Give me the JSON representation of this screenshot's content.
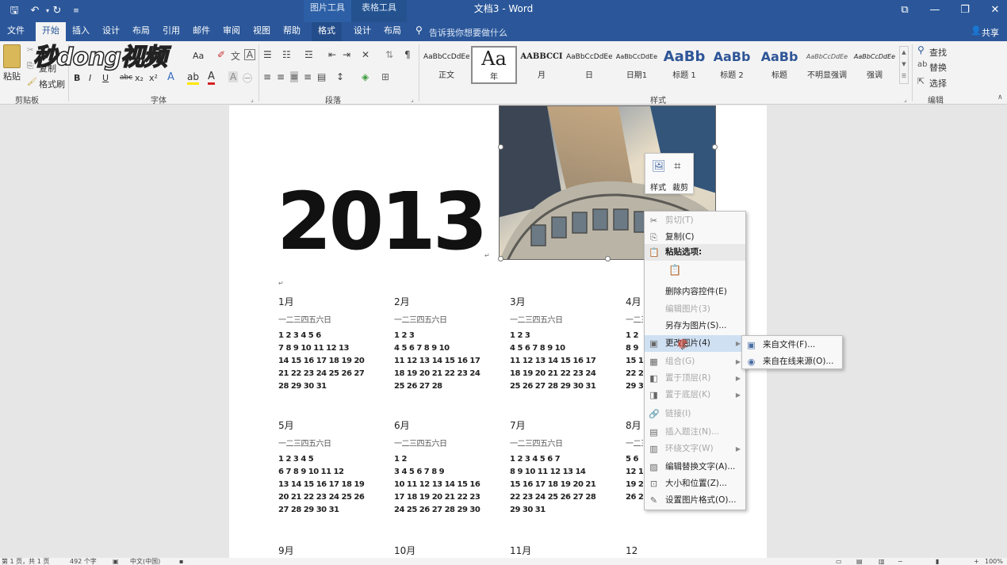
{
  "titlebar": {
    "title": "文档3 - Word",
    "context_tab_picture": "图片工具",
    "context_tab_table": "表格工具",
    "window_buttons": [
      "ribbon-display",
      "minimize",
      "restore",
      "close"
    ]
  },
  "tabs": [
    {
      "label": "文件"
    },
    {
      "label": "开始"
    },
    {
      "label": "插入"
    },
    {
      "label": "设计"
    },
    {
      "label": "布局"
    },
    {
      "label": "引用"
    },
    {
      "label": "邮件"
    },
    {
      "label": "审阅"
    },
    {
      "label": "视图"
    },
    {
      "label": "帮助"
    },
    {
      "label": "格式"
    },
    {
      "label": "设计"
    },
    {
      "label": "布局"
    }
  ],
  "tellme": "告诉我你想要做什么",
  "share": "共享",
  "ribbon": {
    "clipboard": {
      "paste": "粘贴",
      "copy": "复制",
      "format_painter": "格式刷",
      "label": "剪贴板"
    },
    "font": {
      "label": "字体",
      "case": "Aa",
      "bold": "B",
      "italic": "I",
      "underline": "U",
      "strike": "abc",
      "sub": "x₂",
      "sup": "x²"
    },
    "paragraph": {
      "label": "段落"
    },
    "styles": {
      "label": "样式",
      "items": [
        {
          "sample": "AaBbCcDdEe",
          "name": "正文"
        },
        {
          "sample": "Aa",
          "name": "年"
        },
        {
          "sample": "AABBCCI",
          "name": "月"
        },
        {
          "sample": "AaBbCcDdEe",
          "name": "日"
        },
        {
          "sample": "AaBbCcDdEe",
          "name": "日期1"
        },
        {
          "sample": "AaBb",
          "name": "标题 1"
        },
        {
          "sample": "AaBb",
          "name": "标题 2"
        },
        {
          "sample": "AaBb",
          "name": "标题"
        },
        {
          "sample": "AaBbCcDdEe",
          "name": "不明显强调"
        },
        {
          "sample": "AaBbCcDdEe",
          "name": "强调"
        }
      ]
    },
    "editing": {
      "label": "编辑",
      "find": "查找",
      "replace": "替换",
      "select": "选择"
    }
  },
  "watermark": "秒dong视频",
  "document": {
    "year": "2013",
    "weekday_header": "一二三四五六日",
    "months": [
      {
        "name": "1月",
        "rows": [
          "1 2 3 4 5 6",
          "7 8 9 10 11 12 13",
          "14 15 16 17 18 19 20",
          "21 22 23 24 25 26 27",
          "28 29 30 31"
        ]
      },
      {
        "name": "2月",
        "rows": [
          "1 2 3",
          "4 5 6 7 8 9 10",
          "11 12 13 14 15 16 17",
          "18 19 20 21 22 23 24",
          "25 26 27 28"
        ]
      },
      {
        "name": "3月",
        "rows": [
          "1 2 3",
          "4 5 6 7 8 9 10",
          "11 12 13 14 15 16 17",
          "18 19 20 21 22 23 24",
          "25 26 27 28 29 30 31"
        ]
      },
      {
        "name": "4月",
        "rows": [
          "1 2",
          "8 9",
          "15 16",
          "22 23",
          "29 30"
        ]
      },
      {
        "name": "5月",
        "rows": [
          "1 2 3 4 5",
          "6 7 8 9 10 11 12",
          "13 14 15 16 17 18 19",
          "20 21 22 23 24 25 26",
          "27 28 29 30 31"
        ]
      },
      {
        "name": "6月",
        "rows": [
          "1 2",
          "3 4 5 6 7 8 9",
          "10 11 12 13 14 15 16",
          "17 18 19 20 21 22 23",
          "24 25 26 27 28 29 30"
        ]
      },
      {
        "name": "7月",
        "rows": [
          "1 2 3 4 5 6 7",
          "8 9 10 11 12 13 14",
          "15 16 17 18 19 20 21",
          "22 23 24 25 26 27 28",
          "29 30 31"
        ]
      },
      {
        "name": "8月",
        "rows": [
          "",
          "5 6",
          "12 13",
          "19 20",
          "26 27 28 29 30 31"
        ]
      },
      {
        "name": "9月"
      },
      {
        "name": "10月"
      },
      {
        "name": "11月"
      },
      {
        "name": "12月"
      }
    ]
  },
  "mini_toolbar": {
    "style": "样式",
    "crop": "裁剪"
  },
  "context_menu": {
    "items": [
      {
        "label": "剪切(T)",
        "enabled": false,
        "icon": "scissors-icon"
      },
      {
        "label": "复制(C)",
        "enabled": true,
        "icon": "copy-icon"
      },
      {
        "label": "粘贴选项:",
        "enabled": true,
        "icon": "paste-icon",
        "header": true
      },
      {
        "label": "",
        "enabled": true,
        "icon": "paste-keep-icon",
        "paste_row": true
      },
      {
        "label": "删除内容控件(E)",
        "enabled": true
      },
      {
        "label": "编辑图片(3)",
        "enabled": false
      },
      {
        "label": "另存为图片(S)...",
        "enabled": true
      },
      {
        "label": "更改图片(4)",
        "enabled": true,
        "icon": "change-picture-icon",
        "submenu": true,
        "highlighted": true
      },
      {
        "label": "组合(G)",
        "enabled": false,
        "icon": "group-icon",
        "submenu": true
      },
      {
        "label": "置于顶层(R)",
        "enabled": false,
        "icon": "bring-front-icon",
        "submenu": true
      },
      {
        "label": "置于底层(K)",
        "enabled": false,
        "icon": "send-back-icon",
        "submenu": true
      },
      {
        "label": "链接(I)",
        "enabled": false,
        "icon": "link-icon"
      },
      {
        "label": "插入题注(N)...",
        "enabled": false,
        "icon": "caption-icon"
      },
      {
        "label": "环绕文字(W)",
        "enabled": false,
        "icon": "wrap-icon",
        "submenu": true
      },
      {
        "label": "编辑替换文字(A)...",
        "enabled": true,
        "icon": "alt-text-icon"
      },
      {
        "label": "大小和位置(Z)...",
        "enabled": true,
        "icon": "size-icon"
      },
      {
        "label": "设置图片格式(O)...",
        "enabled": true,
        "icon": "format-picture-icon"
      }
    ]
  },
  "submenu": {
    "items": [
      {
        "label": "来自文件(F)..."
      },
      {
        "label": "来自在线来源(O)..."
      }
    ]
  },
  "statusbar": {
    "page": "第 1 页，共 1 页",
    "words": "492 个字",
    "language": "中文(中国)",
    "zoom": "100%"
  }
}
